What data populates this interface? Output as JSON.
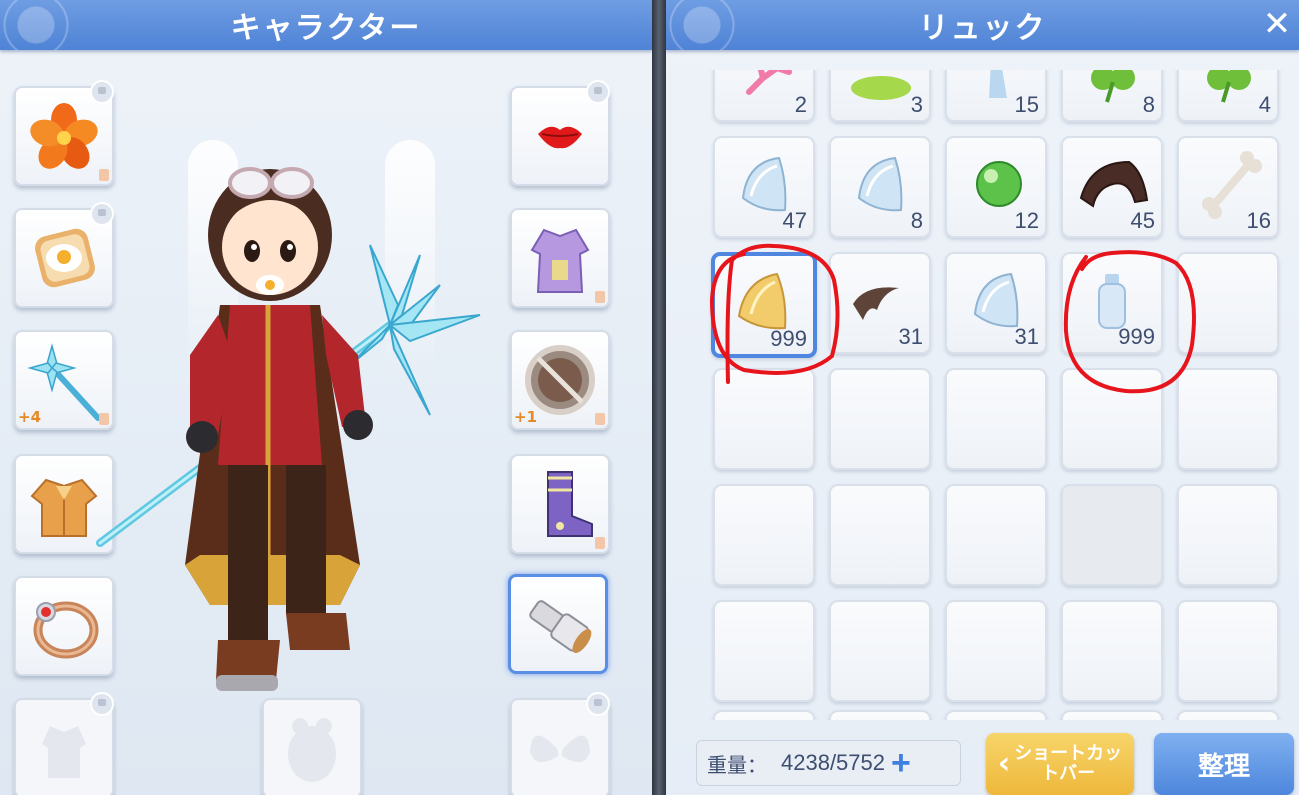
{
  "character_panel": {
    "title": "キャラクター",
    "left_slots": [
      {
        "icon": "flower-icon",
        "refine": ""
      },
      {
        "icon": "toast-egg-icon",
        "refine": ""
      },
      {
        "icon": "crystal-staff-icon",
        "refine": "+4"
      },
      {
        "icon": "jacket-icon",
        "refine": ""
      },
      {
        "icon": "ring-icon",
        "refine": ""
      },
      {
        "icon": "empty-garment-icon",
        "refine": ""
      }
    ],
    "right_slots": [
      {
        "icon": "lips-icon",
        "refine": ""
      },
      {
        "icon": "robe-icon",
        "refine": ""
      },
      {
        "icon": "shield-icon",
        "refine": "+1"
      },
      {
        "icon": "boots-icon",
        "refine": ""
      },
      {
        "icon": "spyglass-icon",
        "refine": ""
      },
      {
        "icon": "wings-icon",
        "refine": ""
      }
    ]
  },
  "bag_panel": {
    "title": "リュック",
    "close_icon": "close-icon",
    "rows": [
      [
        {
          "icon": "coral-icon",
          "qty": "2"
        },
        {
          "icon": "green-slime-icon",
          "qty": "3"
        },
        {
          "icon": "blue-feather-icon",
          "qty": "15"
        },
        {
          "icon": "clover-icon",
          "qty": "8"
        },
        {
          "icon": "clover-icon",
          "qty": "4"
        }
      ],
      [
        {
          "icon": "blue-shell-icon",
          "qty": "47"
        },
        {
          "icon": "blue-shell-icon",
          "qty": "8"
        },
        {
          "icon": "green-orb-icon",
          "qty": "12"
        },
        {
          "icon": "dark-shell-icon",
          "qty": "45"
        },
        {
          "icon": "bone-icon",
          "qty": "16"
        }
      ],
      [
        {
          "icon": "gold-shell-icon",
          "qty": "999",
          "selected": true
        },
        {
          "icon": "brown-feather-icon",
          "qty": "31"
        },
        {
          "icon": "blue-shell-icon",
          "qty": "31"
        },
        {
          "icon": "empty-bottle-icon",
          "qty": "999"
        },
        {
          "icon": "",
          "qty": ""
        }
      ]
    ],
    "weight_label": "重量：",
    "weight_value": "4238/5752",
    "weight_plus": "+",
    "shortcut_label_1": "ショートカッ",
    "shortcut_label_2": "トバー",
    "sort_label": "整理"
  },
  "colors": {
    "header_blue": "#4f83d6",
    "quantity_text": "#3e4e70",
    "annotation_red": "#e8141c",
    "shortcut_gold": "#eeb83b",
    "sort_blue": "#4d86dc"
  }
}
